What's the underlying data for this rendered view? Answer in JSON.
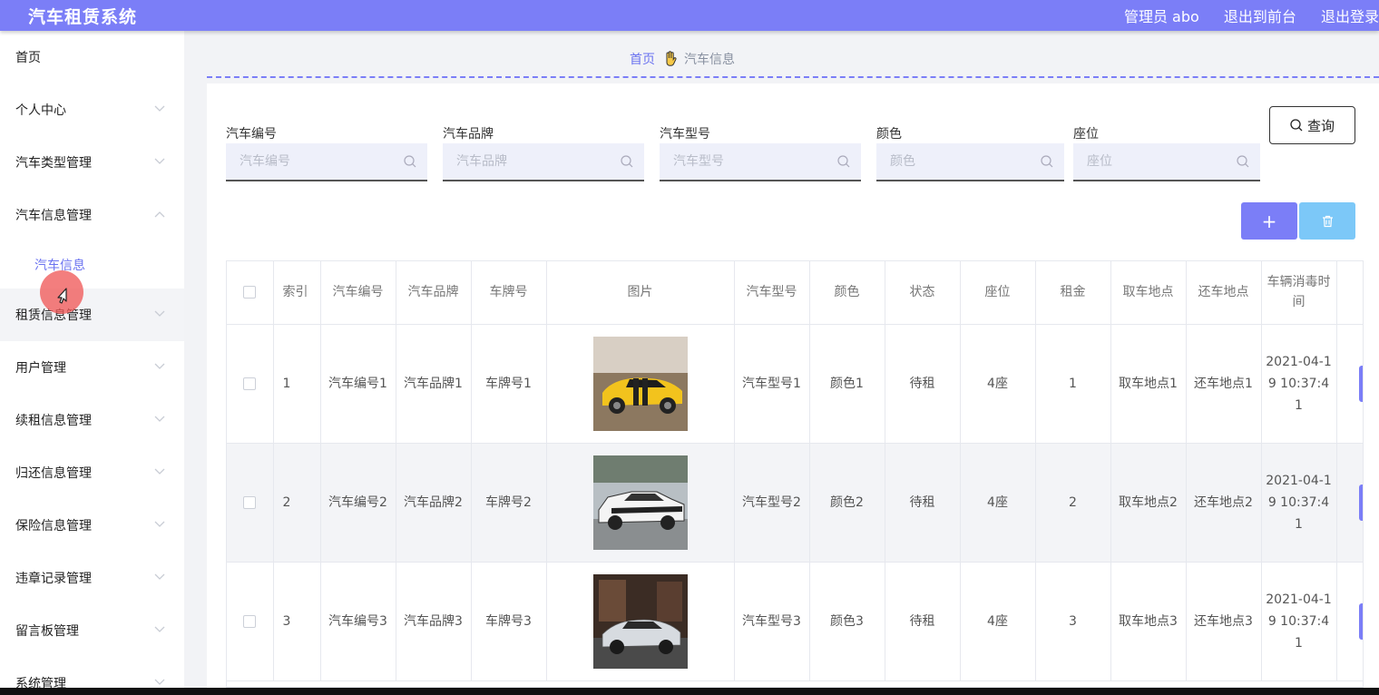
{
  "header": {
    "title": "汽车租赁系统",
    "user": "管理员 abo",
    "to_front": "退出到前台",
    "logout": "退出登录"
  },
  "sidebar": {
    "items": [
      {
        "label": "首页"
      },
      {
        "label": "个人中心"
      },
      {
        "label": "汽车类型管理"
      },
      {
        "label": "汽车信息管理"
      },
      {
        "label": "汽车信息"
      },
      {
        "label": "租赁信息管理"
      },
      {
        "label": "用户管理"
      },
      {
        "label": "续租信息管理"
      },
      {
        "label": "归还信息管理"
      },
      {
        "label": "保险信息管理"
      },
      {
        "label": "违章记录管理"
      },
      {
        "label": "留言板管理"
      },
      {
        "label": "系统管理"
      }
    ]
  },
  "breadcrumb": {
    "home": "首页",
    "current": "汽车信息"
  },
  "search": {
    "fields": [
      {
        "label": "汽车编号",
        "placeholder": "汽车编号"
      },
      {
        "label": "汽车品牌",
        "placeholder": "汽车品牌"
      },
      {
        "label": "汽车型号",
        "placeholder": "汽车型号"
      },
      {
        "label": "颜色",
        "placeholder": "颜色"
      },
      {
        "label": "座位",
        "placeholder": "座位"
      }
    ],
    "query_label": "查询",
    "add_label": "+"
  },
  "table": {
    "headers": [
      "索引",
      "汽车编号",
      "汽车品牌",
      "车牌号",
      "图片",
      "汽车型号",
      "颜色",
      "状态",
      "座位",
      "租金",
      "取车地点",
      "还车地点",
      "车辆消毒时间"
    ],
    "rows": [
      {
        "index": "1",
        "code": "汽车编号1",
        "brand": "汽车品牌1",
        "plate": "车牌号1",
        "model": "汽车型号1",
        "color": "颜色1",
        "status": "待租",
        "seats": "4座",
        "rent": "1",
        "pickup": "取车地点1",
        "return": "还车地点1",
        "disinfect": "2021-04-19 10:37:41"
      },
      {
        "index": "2",
        "code": "汽车编号2",
        "brand": "汽车品牌2",
        "plate": "车牌号2",
        "model": "汽车型号2",
        "color": "颜色2",
        "status": "待租",
        "seats": "4座",
        "rent": "2",
        "pickup": "取车地点2",
        "return": "还车地点2",
        "disinfect": "2021-04-19 10:37:41"
      },
      {
        "index": "3",
        "code": "汽车编号3",
        "brand": "汽车品牌3",
        "plate": "车牌号3",
        "model": "汽车型号3",
        "color": "颜色3",
        "status": "待租",
        "seats": "4座",
        "rent": "3",
        "pickup": "取车地点3",
        "return": "还车地点3",
        "disinfect": "2021-04-19 10:37:41"
      }
    ]
  },
  "colors": {
    "accent": "#7b7ef7",
    "delete": "#7cc8f8",
    "link": "#6b73f0"
  }
}
